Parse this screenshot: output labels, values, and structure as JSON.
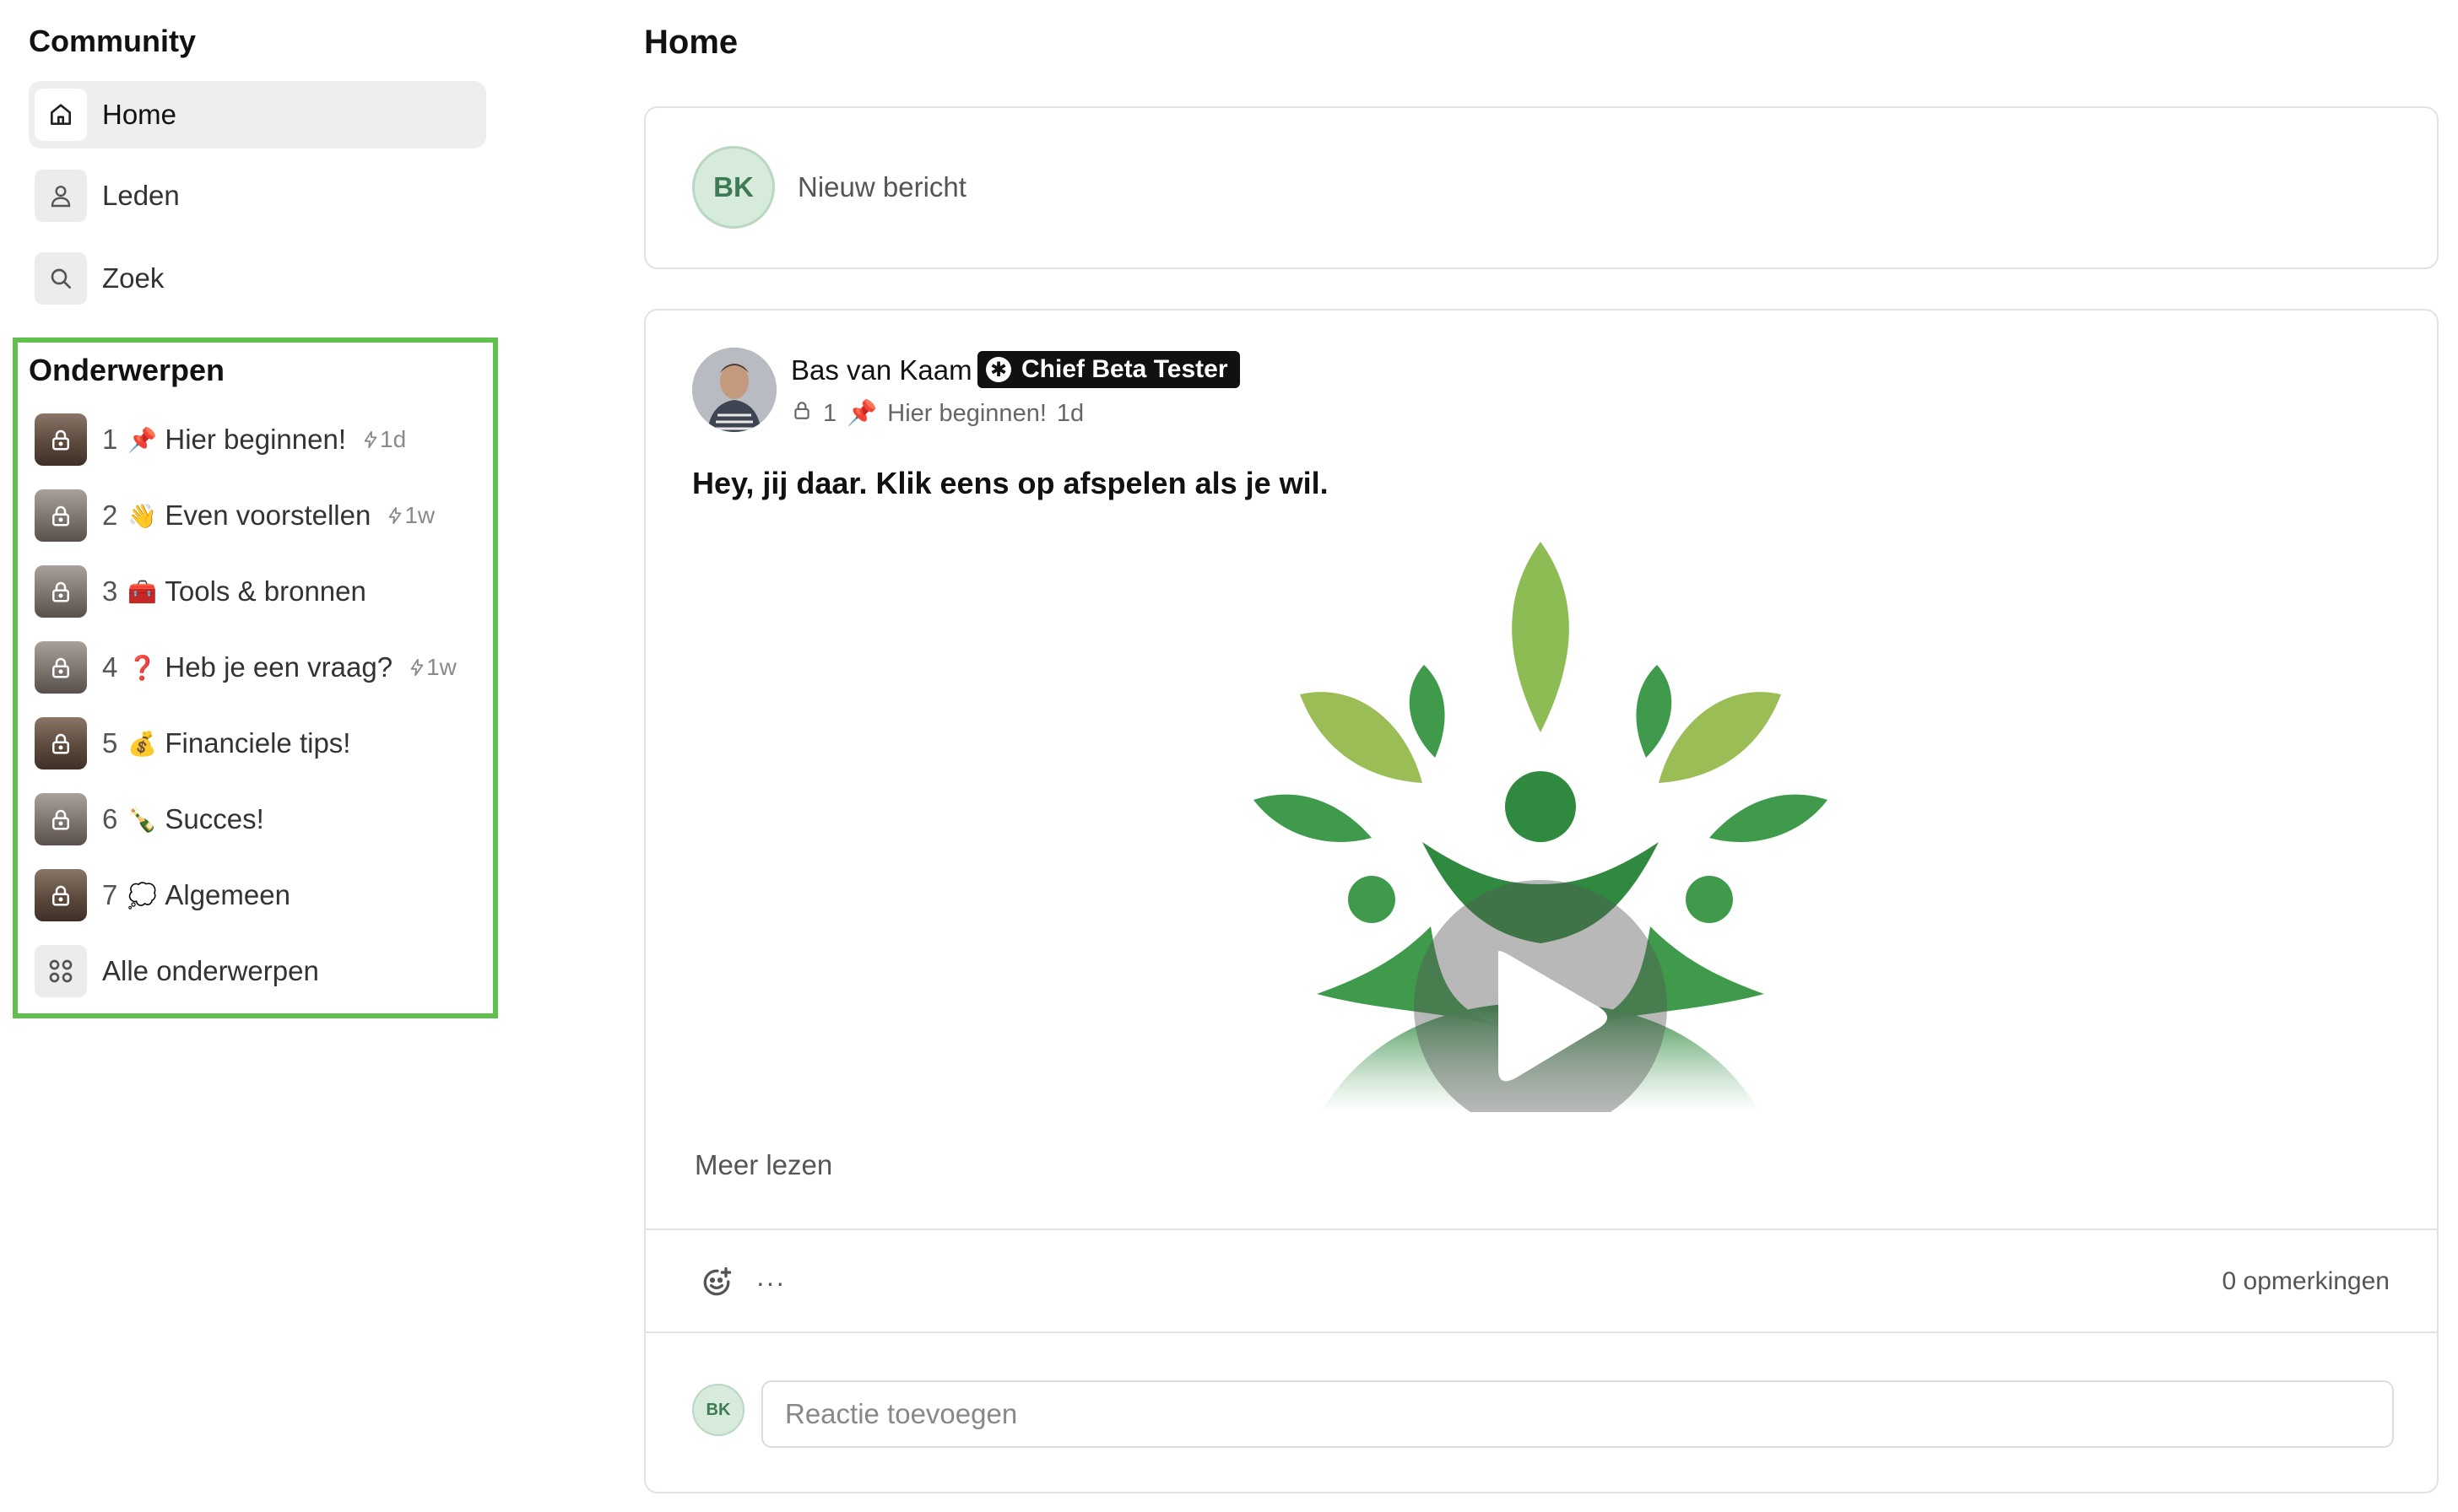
{
  "sidebar": {
    "community_title": "Community",
    "nav": [
      {
        "label": "Home",
        "icon": "home-icon",
        "active": true
      },
      {
        "label": "Leden",
        "icon": "user-icon",
        "active": false
      },
      {
        "label": "Zoek",
        "icon": "search-icon",
        "active": false
      }
    ],
    "topics_title": "Onderwerpen",
    "topics": [
      {
        "num": "1",
        "emoji": "📌",
        "label": "Hier beginnen!",
        "activity": "1d"
      },
      {
        "num": "2",
        "emoji": "👋",
        "label": "Even voorstellen",
        "activity": "1w"
      },
      {
        "num": "3",
        "emoji": "🧰",
        "label": "Tools & bronnen",
        "activity": ""
      },
      {
        "num": "4",
        "emoji": "❓",
        "label": "Heb je een vraag?",
        "activity": "1w"
      },
      {
        "num": "5",
        "emoji": "💰",
        "label": "Financiele tips!",
        "activity": ""
      },
      {
        "num": "6",
        "emoji": "🍾",
        "label": "Succes!",
        "activity": ""
      },
      {
        "num": "7",
        "emoji": "💭",
        "label": "Algemeen",
        "activity": ""
      }
    ],
    "all_topics_label": "Alle onderwerpen",
    "highlight_color": "#5fc04e"
  },
  "main": {
    "title": "Home",
    "composer": {
      "avatar_initials": "BK",
      "placeholder": "Nieuw bericht"
    },
    "post": {
      "author": "Bas van Kaam",
      "badge": "Chief Beta Tester",
      "topic_num": "1",
      "topic_emoji": "📌",
      "topic_label": "Hier beginnen!",
      "age": "1d",
      "heading": "Hey, jij daar. Klik eens op afspelen als je wil.",
      "read_more": "Meer lezen",
      "more_menu": "···",
      "comments_count": "0 opmerkingen",
      "comment_avatar_initials": "BK",
      "comment_placeholder": "Reactie toevoegen"
    }
  }
}
